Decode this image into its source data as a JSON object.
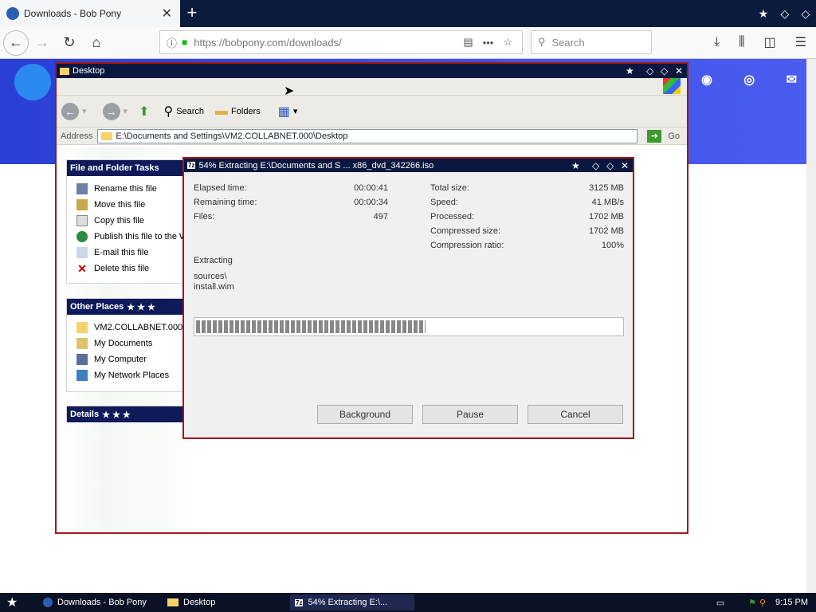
{
  "browser": {
    "tab_title": "Downloads - Bob Pony",
    "url": "https://bobpony.com/downloads/",
    "search_placeholder": "Search"
  },
  "explorer": {
    "title": "Desktop",
    "toolbar": {
      "search_label": "Search",
      "folders_label": "Folders"
    },
    "address_label": "Address",
    "address_value": "E:\\Documents and Settings\\VM2.COLLABNET.000\\Desktop",
    "go_label": "Go",
    "panes": {
      "tasks": {
        "title": "File and Folder Tasks",
        "items": [
          "Rename this file",
          "Move this file",
          "Copy this file",
          "Publish this file to the W",
          "E-mail this file",
          "Delete this file"
        ]
      },
      "places": {
        "title": "Other Places",
        "items": [
          "VM2.COLLABNET.000",
          "My Documents",
          "My Computer",
          "My Network Places"
        ]
      },
      "details": {
        "title": "Details"
      }
    }
  },
  "dialog": {
    "title": "54% Extracting E:\\Documents and S ... x86_dvd_342266.iso",
    "left_stats": [
      {
        "label": "Elapsed time:",
        "value": "00:00:41"
      },
      {
        "label": "Remaining time:",
        "value": "00:00:34"
      },
      {
        "label": "Files:",
        "value": "497"
      }
    ],
    "right_stats": [
      {
        "label": "Total size:",
        "value": "3125 MB"
      },
      {
        "label": "Speed:",
        "value": "41 MB/s"
      },
      {
        "label": "Processed:",
        "value": "1702 MB"
      },
      {
        "label": "Compressed size:",
        "value": "1702 MB"
      },
      {
        "label": "Compression ratio:",
        "value": "100%"
      }
    ],
    "extracting_label": "Extracting",
    "current_path": "sources\\",
    "current_file": "install.wim",
    "progress_fraction": 0.54,
    "buttons": {
      "background": "Background",
      "pause": "Pause",
      "cancel": "Cancel"
    }
  },
  "taskbar": {
    "tasks": [
      "Downloads - Bob Pony",
      "Desktop",
      "54% Extracting E:\\..."
    ],
    "clock": "9:15 PM"
  }
}
